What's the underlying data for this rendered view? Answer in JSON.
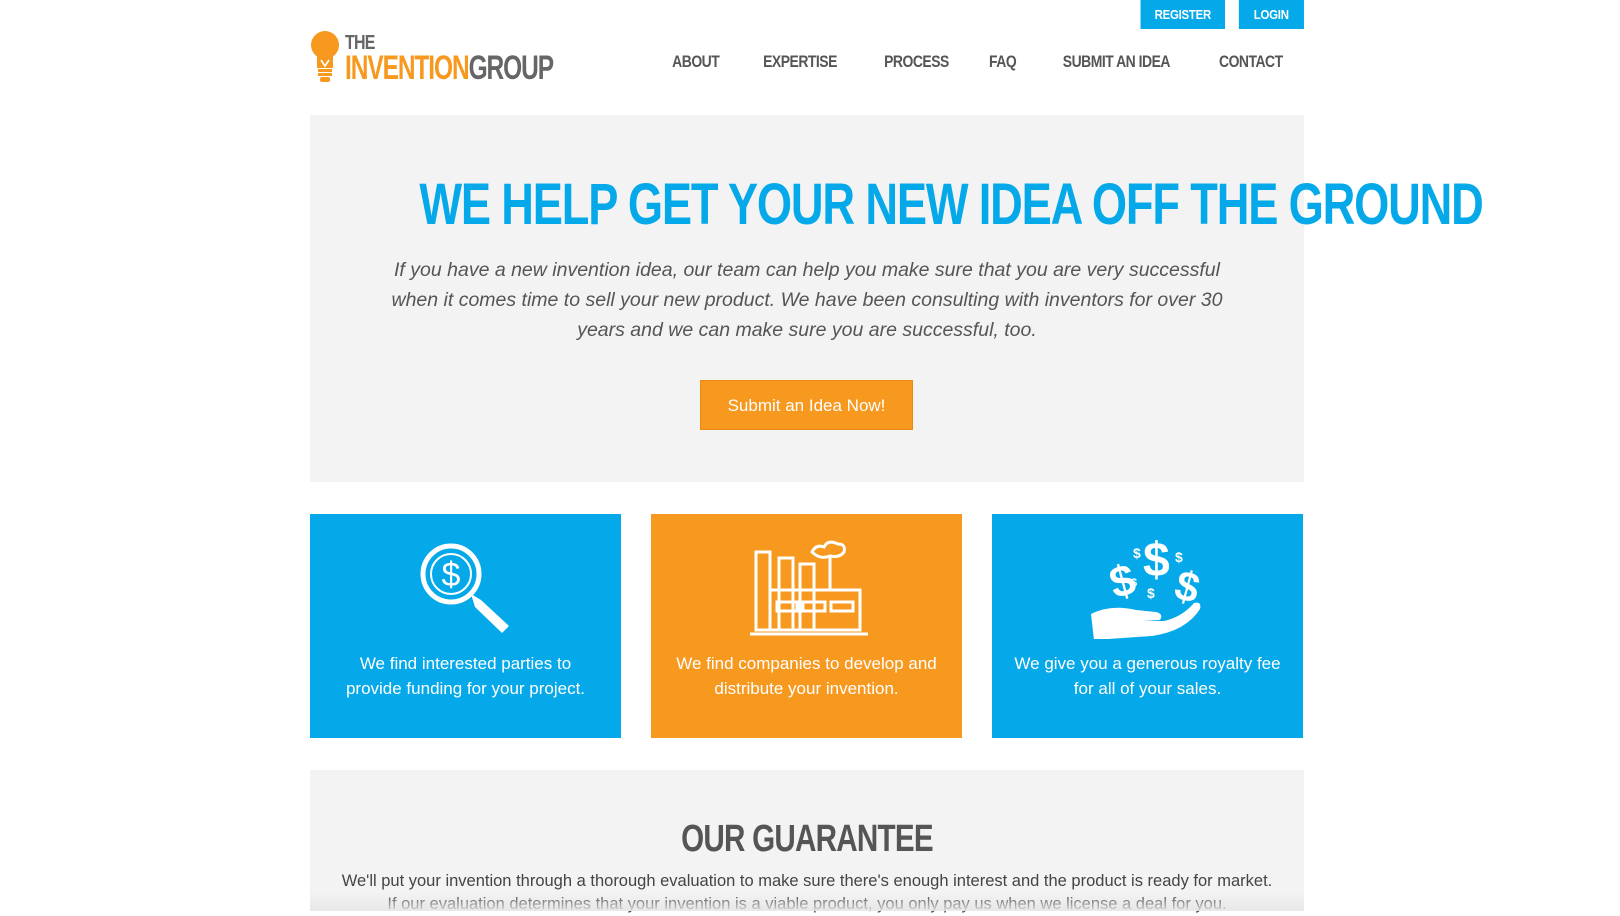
{
  "header": {
    "register_label": "REGISTER",
    "login_label": "LOGIN",
    "logo": {
      "the": "THE",
      "invention": "INVENTION",
      "group": "GROUP"
    },
    "nav": [
      "ABOUT",
      "EXPERTISE",
      "PROCESS",
      "FAQ",
      "SUBMIT AN IDEA",
      "CONTACT"
    ]
  },
  "hero": {
    "title": "WE HELP GET YOUR NEW IDEA OFF THE GROUND",
    "body": "If you have a new invention idea, our team can help you make sure that you are very successful when it comes time to sell your new product. We have been consulting with inventors for over 30 years and we can make sure you are successful, too.",
    "cta_label": "Submit an Idea Now!"
  },
  "features": [
    {
      "icon": "magnifier-dollar-icon",
      "text": "We find interested parties to provide funding for your project.",
      "color": "#05a8e8"
    },
    {
      "icon": "factory-icon",
      "text": "We find companies to develop and distribute your invention.",
      "color": "#f7981f"
    },
    {
      "icon": "hand-money-icon",
      "text": "We give you a generous royalty fee for all of your sales.",
      "color": "#05a8e8"
    }
  ],
  "guarantee": {
    "title": "OUR GUARANTEE",
    "body": "We'll put your invention through a thorough evaluation to make sure there's enough interest and the product is ready for market. If our evaluation determines that your invention is a viable product, you only pay us when we license a deal for you."
  },
  "colors": {
    "blue": "#05a8e8",
    "orange": "#f7981f",
    "gray_panel": "#f3f3f3",
    "text": "#555555"
  }
}
